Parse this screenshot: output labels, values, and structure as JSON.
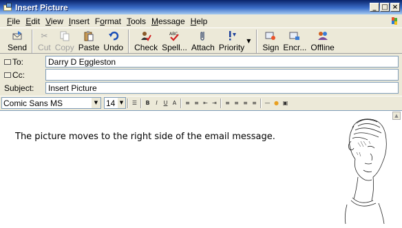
{
  "window": {
    "title": "Insert Picture"
  },
  "window_controls": {
    "minimize": "_",
    "maximize": "□",
    "close": "×"
  },
  "menu": [
    {
      "pre": "",
      "ul": "F",
      "post": "ile"
    },
    {
      "pre": "",
      "ul": "E",
      "post": "dit"
    },
    {
      "pre": "",
      "ul": "V",
      "post": "iew"
    },
    {
      "pre": "",
      "ul": "I",
      "post": "nsert"
    },
    {
      "pre": "F",
      "ul": "o",
      "post": "rmat"
    },
    {
      "pre": "",
      "ul": "T",
      "post": "ools"
    },
    {
      "pre": "",
      "ul": "M",
      "post": "essage"
    },
    {
      "pre": "",
      "ul": "H",
      "post": "elp"
    }
  ],
  "toolbar": {
    "send": "Send",
    "cut": "Cut",
    "copy": "Copy",
    "paste": "Paste",
    "undo": "Undo",
    "check": "Check",
    "spell": "Spell...",
    "attach": "Attach",
    "priority": "Priority",
    "sign": "Sign",
    "encrypt": "Encr...",
    "offline": "Offline"
  },
  "header": {
    "to_label": "To:",
    "to_value": "Darry D Eggleston",
    "cc_label": "Cc:",
    "cc_value": "",
    "subject_label": "Subject:",
    "subject_value": "Insert Picture"
  },
  "format": {
    "font": "Comic Sans MS",
    "size": "14"
  },
  "body": {
    "text": "The picture moves to the right side of the email message."
  },
  "colors": {
    "titlebar": "#0a246a",
    "chrome": "#ece9d8",
    "field_border": "#7f9db9"
  }
}
